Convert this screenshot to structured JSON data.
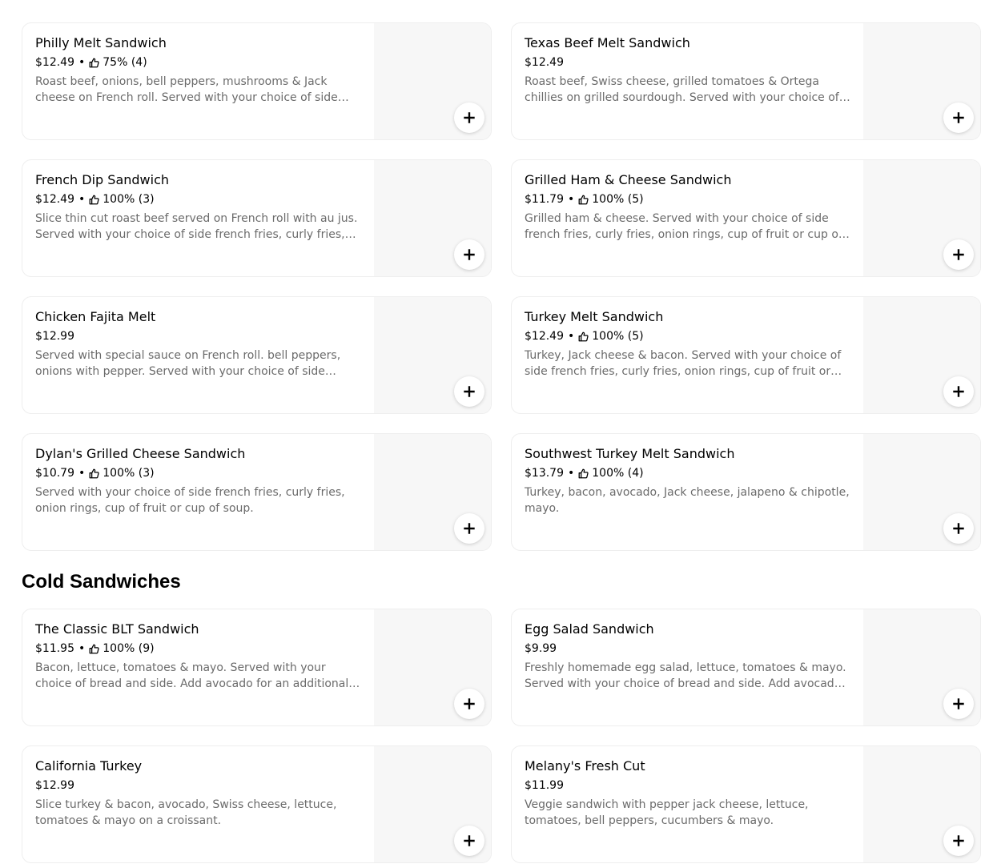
{
  "hot_sandwiches": {
    "items": [
      {
        "name": "Philly Melt Sandwich",
        "price": "$12.49",
        "rating": "75% (4)",
        "description": "Roast beef, onions, bell peppers, mushrooms & Jack cheese on French roll. Served with your choice of side french fries, curly fries, onion rings, cup of fruit or cup of soup."
      },
      {
        "name": "Texas Beef Melt Sandwich",
        "price": "$12.49",
        "rating": "",
        "description": "Roast beef, Swiss cheese, grilled tomatoes & Ortega chillies on grilled sourdough. Served with your choice of side french fries, curly fries, onion rings, cup of fruit or cup of soup."
      },
      {
        "name": "French Dip Sandwich",
        "price": "$12.49",
        "rating": "100% (3)",
        "description": "Slice thin cut roast beef served on French roll with au jus. Served with your choice of side french fries, curly fries, onion rings, cup of fruit or cup of soup."
      },
      {
        "name": "Grilled Ham & Cheese Sandwich",
        "price": "$11.79",
        "rating": "100% (5)",
        "description": "Grilled ham & cheese. Served with your choice of side french fries, curly fries, onion rings, cup of fruit or cup of soup."
      },
      {
        "name": "Chicken Fajita Melt",
        "price": "$12.99",
        "rating": "",
        "description": "Served with special sauce on French roll. bell peppers, onions with pepper. Served with your choice of side french fries, curly fries, onion rings, cup of fruit or cup of soup."
      },
      {
        "name": "Turkey Melt Sandwich",
        "price": "$12.49",
        "rating": "100% (5)",
        "description": "Turkey, Jack cheese & bacon. Served with your choice of side french fries, curly fries, onion rings, cup of fruit or cup of soup."
      },
      {
        "name": "Dylan's Grilled Cheese Sandwich",
        "price": "$10.79",
        "rating": "100% (3)",
        "description": "Served with your choice of side french fries, curly fries, onion rings, cup of fruit or cup of soup."
      },
      {
        "name": "Southwest Turkey Melt Sandwich",
        "price": "$13.79",
        "rating": "100% (4)",
        "description": "Turkey, bacon, avocado, Jack cheese, jalapeno & chipotle, mayo."
      }
    ]
  },
  "cold_sandwiches": {
    "title": "Cold Sandwiches",
    "items": [
      {
        "name": "The Classic BLT Sandwich",
        "price": "$11.95",
        "rating": "100% (9)",
        "description": "Bacon, lettuce, tomatoes & mayo. Served with your choice of bread and side. Add avocado for an additional charge."
      },
      {
        "name": "Egg Salad Sandwich",
        "price": "$9.99",
        "rating": "",
        "description": "Freshly homemade egg salad, lettuce, tomatoes & mayo. Served with your choice of bread and side. Add avocado for an additional charge."
      },
      {
        "name": "California Turkey",
        "price": "$12.99",
        "rating": "",
        "description": "Slice turkey & bacon, avocado, Swiss cheese, lettuce, tomatoes & mayo on a croissant."
      },
      {
        "name": "Melany's Fresh Cut",
        "price": "$11.99",
        "rating": "",
        "description": "Veggie sandwich with pepper jack cheese, lettuce, tomatoes, bell peppers, cucumbers & mayo."
      }
    ]
  },
  "icons": {
    "rating": "thumbs-up-icon",
    "add": "plus-icon",
    "separator": "•"
  },
  "colors": {
    "description_text": "#6b6b6b",
    "photo_placeholder": "#f7f7f7",
    "card_border": "#eeeeee"
  }
}
